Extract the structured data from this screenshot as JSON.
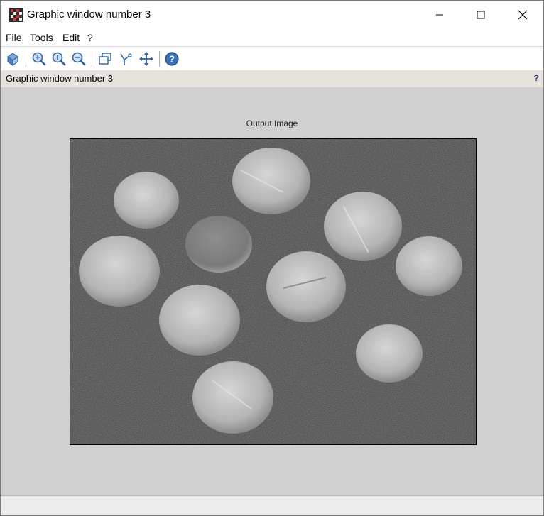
{
  "window": {
    "title": "Graphic window number 3"
  },
  "menubar": {
    "items": [
      "File",
      "Tools",
      "Edit",
      "?"
    ]
  },
  "toolbar": {
    "buttons": [
      "rotate-icon",
      "zoom-in-icon",
      "zoom-reset-icon",
      "zoom-out-icon",
      "window-icon",
      "datatip-icon",
      "pan-icon",
      "help-icon"
    ]
  },
  "infobar": {
    "text": "Graphic window number 3",
    "help": "?"
  },
  "plot": {
    "title": "Output Image",
    "image_description": "grayscale image of coins on dark noisy background"
  },
  "colors": {
    "canvas_bg": "#d0d0d0",
    "infobar_bg": "#e6e3dc",
    "image_bg": "#3e3e3e"
  }
}
